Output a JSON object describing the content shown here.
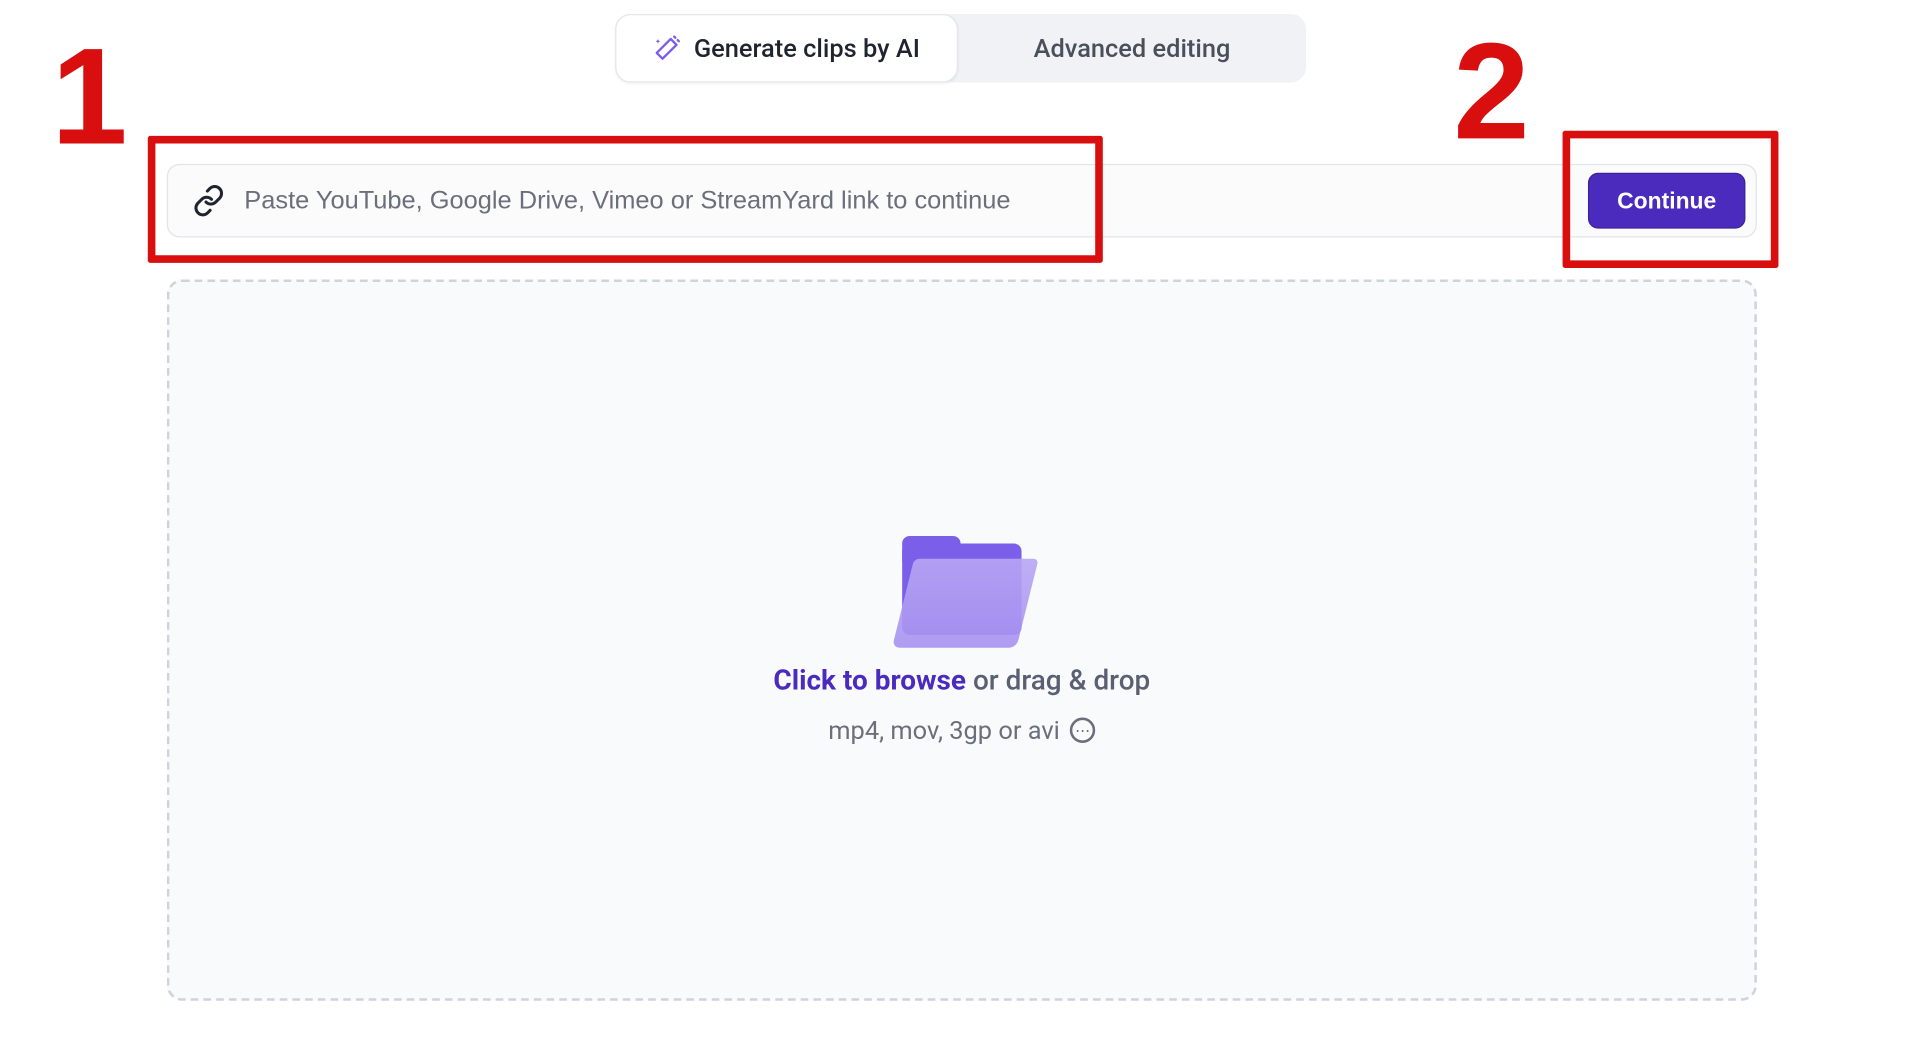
{
  "tabs": {
    "generate_label": "Generate clips by AI",
    "advanced_label": "Advanced editing"
  },
  "link_row": {
    "placeholder": "Paste YouTube, Google Drive, Vimeo or StreamYard link to continue",
    "continue_label": "Continue"
  },
  "dropzone": {
    "browse_label": "Click to browse",
    "drag_label": " or drag & drop",
    "formats_label": "mp4, mov, 3gp or avi",
    "info_glyph": "⋯"
  },
  "annotations": {
    "num1": "1",
    "num2": "2"
  },
  "colors": {
    "accent": "#4b2bbd",
    "annotation": "#d90e0e"
  }
}
